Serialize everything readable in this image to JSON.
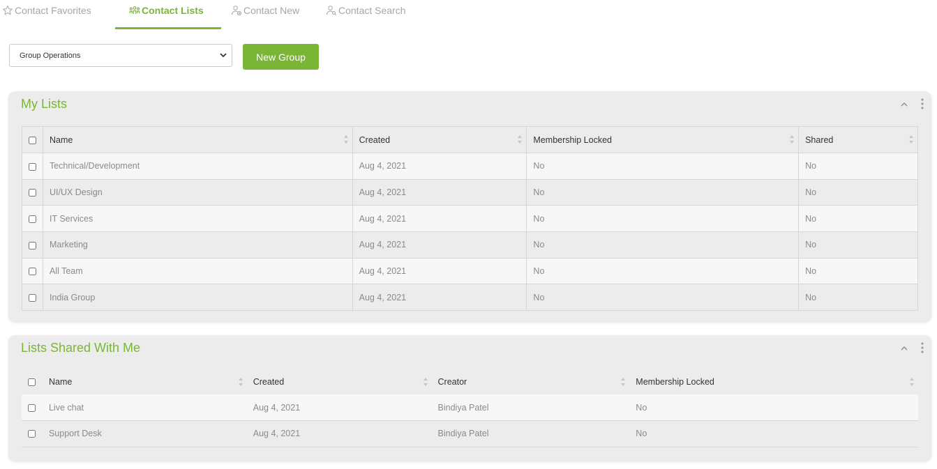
{
  "tabs": [
    {
      "label": "Contact Favorites",
      "icon": "star-outline-icon"
    },
    {
      "label": "Contact Lists",
      "icon": "people-group-icon"
    },
    {
      "label": "Contact New",
      "icon": "user-add-icon"
    },
    {
      "label": "Contact Search",
      "icon": "user-search-icon"
    }
  ],
  "active_tab": "Contact Lists",
  "toolbar": {
    "group_select_value": "Group Operations",
    "new_group_label": "New Group"
  },
  "colors": {
    "accent": "#7ab536",
    "panel_bg": "#ebeceb",
    "muted_text": "#8a8a8a"
  },
  "my_lists": {
    "title": "My Lists",
    "columns": [
      "Name",
      "Created",
      "Membership Locked",
      "Shared"
    ],
    "rows": [
      {
        "name": "Technical/Development",
        "created": "Aug 4, 2021",
        "locked": "No",
        "shared": "No"
      },
      {
        "name": "UI/UX Design",
        "created": "Aug 4, 2021",
        "locked": "No",
        "shared": "No"
      },
      {
        "name": "IT Services",
        "created": "Aug 4, 2021",
        "locked": "No",
        "shared": "No"
      },
      {
        "name": "Marketing",
        "created": "Aug 4, 2021",
        "locked": "No",
        "shared": "No"
      },
      {
        "name": "All Team",
        "created": "Aug 4, 2021",
        "locked": "No",
        "shared": "No"
      },
      {
        "name": "India Group",
        "created": "Aug 4, 2021",
        "locked": "No",
        "shared": "No"
      }
    ]
  },
  "shared_lists": {
    "title": "Lists Shared With Me",
    "columns": [
      "Name",
      "Created",
      "Creator",
      "Membership Locked"
    ],
    "rows": [
      {
        "name": "Live chat",
        "created": "Aug 4, 2021",
        "creator": "Bindiya Patel",
        "locked": "No"
      },
      {
        "name": "Support Desk",
        "created": "Aug 4, 2021",
        "creator": "Bindiya Patel",
        "locked": "No"
      }
    ]
  }
}
